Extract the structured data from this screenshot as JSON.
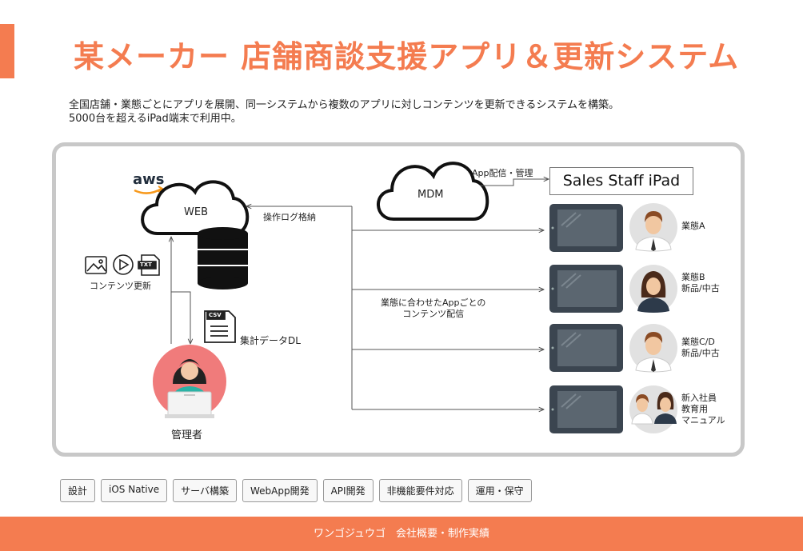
{
  "title": "某メーカー 店舗商談支援アプリ＆更新システム",
  "description": {
    "line1": "全国店舗・業態ごとにアプリを展開、同一システムから複数のアプリに対しコンテンツを更新できるシステムを構築。",
    "line2": "5000台を超えるiPad端末で利用中。"
  },
  "diagram": {
    "aws_logo": "aws",
    "web_label": "WEB",
    "mdm_label": "MDM",
    "app_delivery": "App配信・管理",
    "sales_staff": "Sales Staff iPad",
    "log_storage": "操作ログ格納",
    "content_update": "コンテンツ更新",
    "csv_label": "CSV",
    "txt_label": "TXT",
    "data_dl": "集計データDL",
    "admin": "管理者",
    "delivery_line1": "業態に合わせたAppごとの",
    "delivery_line2": "コンテンツ配信",
    "devices": [
      {
        "line1": "業態A",
        "line2": "",
        "line3": ""
      },
      {
        "line1": "業態B",
        "line2": "新品/中古",
        "line3": ""
      },
      {
        "line1": "業態C/D",
        "line2": "新品/中古",
        "line3": ""
      },
      {
        "line1": "新入社員",
        "line2": "教育用",
        "line3": "マニュアル"
      }
    ]
  },
  "tags": [
    "設計",
    "iOS Native",
    "サーバ構築",
    "WebApp開発",
    "API開発",
    "非機能要件対応",
    "運用・保守"
  ],
  "footer": "ワンゴジュウゴ　会社概要・制作実績",
  "colors": {
    "accent": "#f47c50",
    "tablet": "#3b4550",
    "screen": "#5b6670",
    "admin_circle": "#f07b7b",
    "avatar_bg": "#e1e1e1"
  }
}
